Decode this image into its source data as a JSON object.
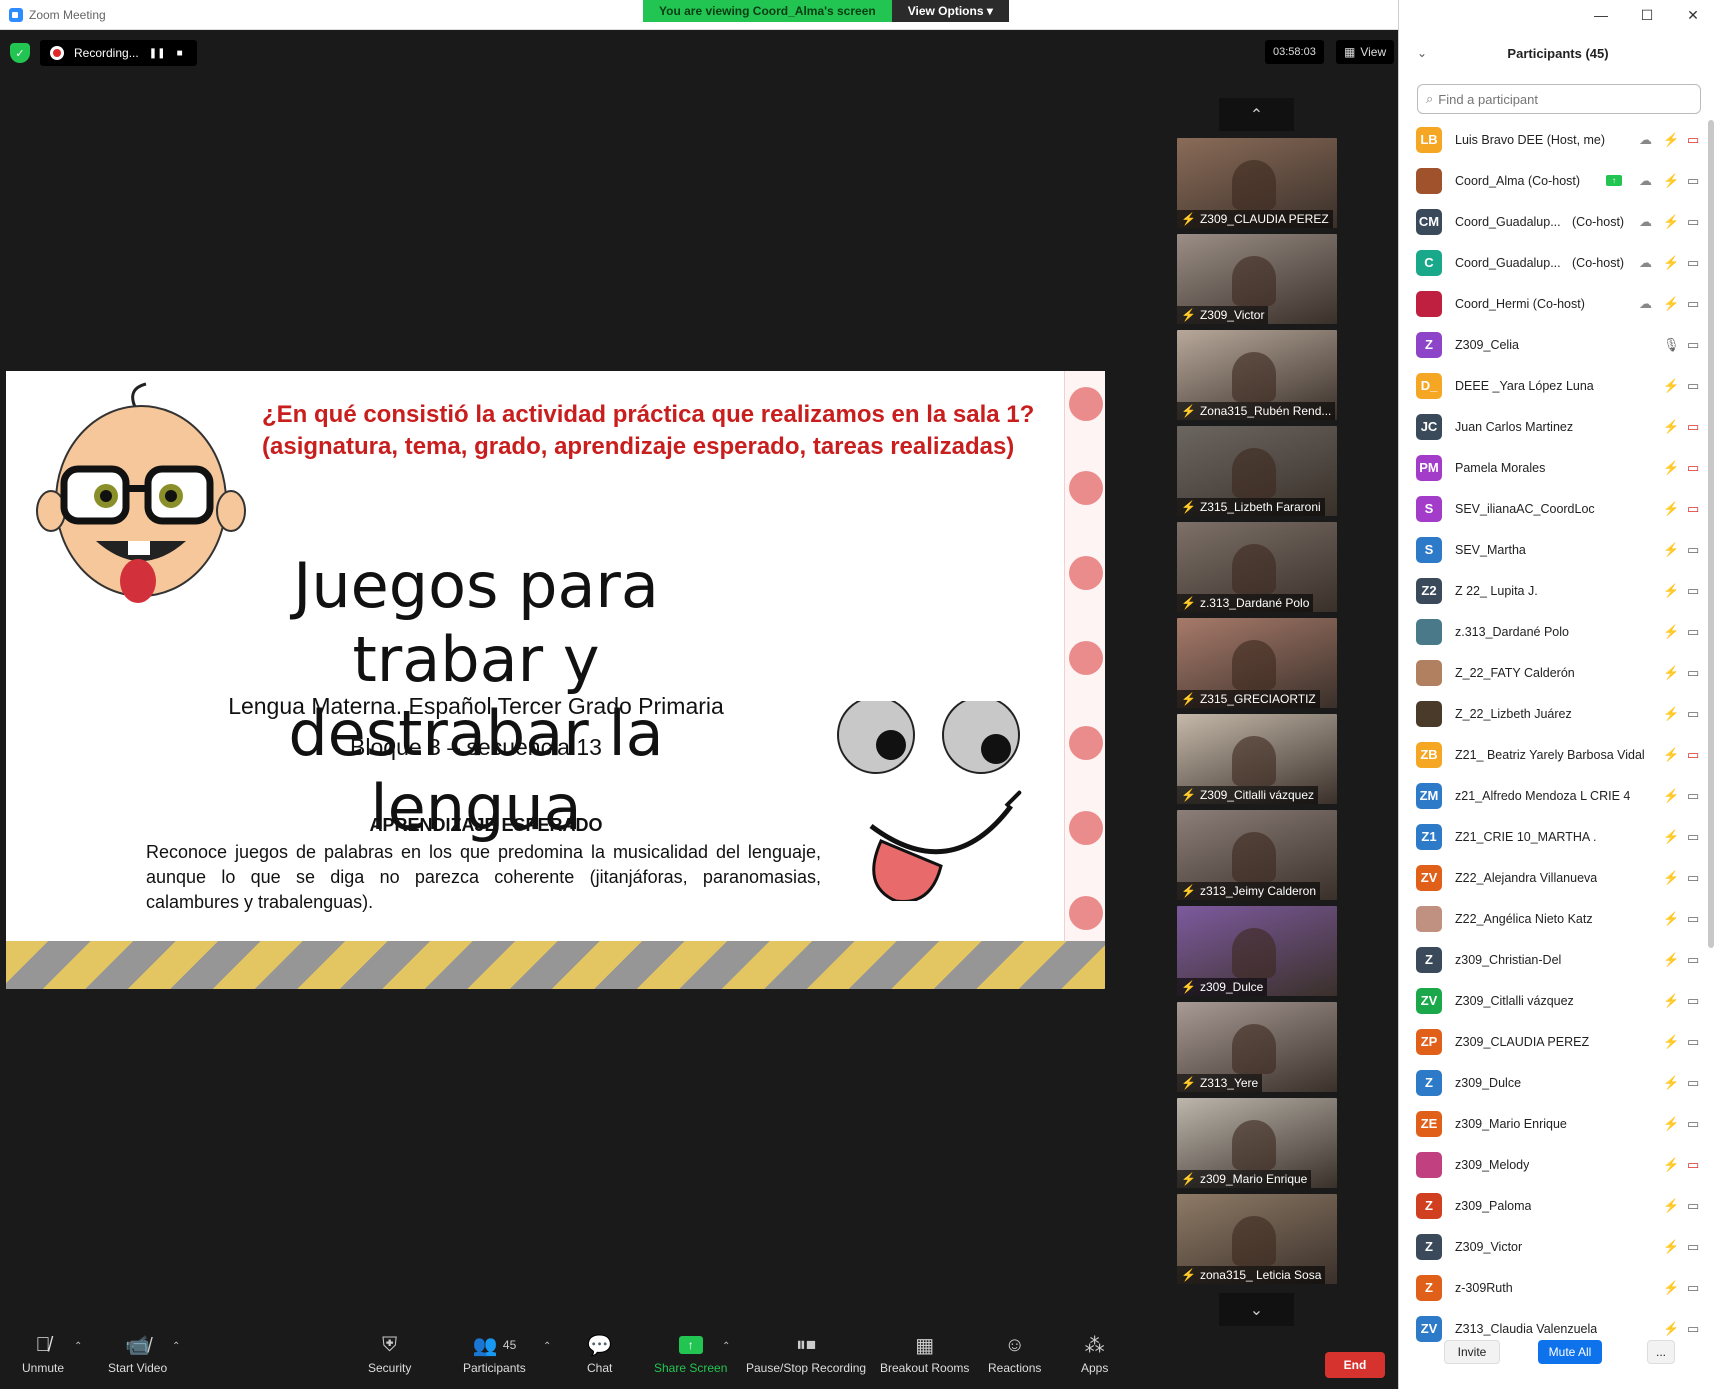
{
  "window": {
    "title": "Zoom Meeting",
    "controls": [
      "—",
      "☐",
      "✕"
    ]
  },
  "banner": {
    "viewing": "You are viewing Coord_Alma's screen",
    "view_options": "View Options ▾"
  },
  "recording": {
    "label": "Recording...",
    "pause": "❚❚",
    "stop": "■"
  },
  "timer": "03:58:03",
  "view_button": "View",
  "slide": {
    "question_line1": "¿En qué consistió la actividad práctica que realizamos en la sala 1?",
    "question_line2": "(asignatura, tema, grado, aprendizaje esperado, tareas realizadas)",
    "title_line1": "Juegos para trabar y",
    "title_line2": "destrabar la lengua",
    "subtitle": "Lengua Materna. Español Tercer Grado Primaria",
    "block": "Bloque 3 – secuencia 13",
    "expected_heading": "APRENDIZAJE ESPERADO",
    "expected_text": "Reconoce juegos de palabras en los que predomina la musicalidad del lenguaje, aunque lo que se diga no parezca coherente (jitanjáforas, paranomasias, calambures y trabalenguas)."
  },
  "gallery": {
    "up_arrow": "⌃",
    "down_arrow": "⌄",
    "tiles": [
      {
        "name": "Z309_CLAUDIA PEREZ",
        "bg": "#8a6b58"
      },
      {
        "name": "Z309_Victor",
        "bg": "#9a8e86"
      },
      {
        "name": "Zona315_Rubén Rend...",
        "bg": "#b7a89a"
      },
      {
        "name": "Z315_Lizbeth Fararoni",
        "bg": "#6c6660"
      },
      {
        "name": "z.313_Dardané Polo",
        "bg": "#7c7068"
      },
      {
        "name": "Z315_GRECIAORTIZ",
        "bg": "#a77a6a"
      },
      {
        "name": "Z309_Citlalli vázquez",
        "bg": "#c5b9aa"
      },
      {
        "name": "z313_Jeimy Calderon",
        "bg": "#8c7e78"
      },
      {
        "name": "z309_Dulce",
        "bg": "#7d5a9e"
      },
      {
        "name": "Z313_Yere",
        "bg": "#a89a94"
      },
      {
        "name": "z309_Mario Enrique",
        "bg": "#bcb6ac"
      },
      {
        "name": "zona315_ Leticia Sosa",
        "bg": "#8e7a66"
      }
    ]
  },
  "toolbar": {
    "unmute": "Unmute",
    "start_video": "Start Video",
    "security": "Security",
    "participants": "Participants",
    "participants_count": "45",
    "chat": "Chat",
    "share_screen": "Share Screen",
    "pause_stop": "Pause/Stop Recording",
    "breakout": "Breakout Rooms",
    "reactions": "Reactions",
    "apps": "Apps",
    "end": "End"
  },
  "panel": {
    "title": "Participants (45)",
    "search_placeholder": "Find a participant",
    "invite": "Invite",
    "mute_all": "Mute All",
    "more": "...",
    "participants": [
      {
        "initials": "LB",
        "color": "#f5a623",
        "name": "Luis Bravo DEE (Host, me)",
        "role": "",
        "cloud": true,
        "share": false,
        "mic_on": false,
        "cam_off": true
      },
      {
        "initials": "",
        "color": "#a0522d",
        "name": "Coord_Alma (Co-host)",
        "role": "",
        "cloud": true,
        "share": true,
        "mic_on": false,
        "cam_off": false
      },
      {
        "initials": "CM",
        "color": "#3a4a5a",
        "name": "Coord_Guadalup...",
        "role": "(Co-host)",
        "cloud": true,
        "share": false,
        "mic_on": false,
        "cam_off": false
      },
      {
        "initials": "C",
        "color": "#1aa88a",
        "name": "Coord_Guadalup...",
        "role": "(Co-host)",
        "cloud": true,
        "share": false,
        "mic_on": false,
        "cam_off": false
      },
      {
        "initials": "",
        "color": "#c02040",
        "name": "Coord_Hermi (Co-host)",
        "role": "",
        "cloud": true,
        "share": false,
        "mic_on": false,
        "cam_off": false
      },
      {
        "initials": "Z",
        "color": "#8e44c9",
        "name": "Z309_Celia",
        "role": "",
        "cloud": false,
        "share": false,
        "mic_on": true,
        "cam_off": false
      },
      {
        "initials": "D_",
        "color": "#f5a623",
        "name": "DEEE _Yara López Luna",
        "role": "",
        "cloud": false,
        "share": false,
        "mic_on": false,
        "cam_off": false
      },
      {
        "initials": "JC",
        "color": "#3a4a5a",
        "name": "Juan Carlos Martinez",
        "role": "",
        "cloud": false,
        "share": false,
        "mic_on": false,
        "cam_off": true
      },
      {
        "initials": "PM",
        "color": "#a23cc9",
        "name": "Pamela Morales",
        "role": "",
        "cloud": false,
        "share": false,
        "mic_on": false,
        "cam_off": true
      },
      {
        "initials": "S",
        "color": "#a23cc9",
        "name": "SEV_ilianaAC_CoordLoc",
        "role": "",
        "cloud": false,
        "share": false,
        "mic_on": false,
        "cam_off": true
      },
      {
        "initials": "S",
        "color": "#2d7ac9",
        "name": "SEV_Martha",
        "role": "",
        "cloud": false,
        "share": false,
        "mic_on": false,
        "cam_off": false
      },
      {
        "initials": "Z2",
        "color": "#3a4a5a",
        "name": "Z 22_ Lupita J.",
        "role": "",
        "cloud": false,
        "share": false,
        "mic_on": false,
        "cam_off": false
      },
      {
        "initials": "",
        "color": "#4a7a8a",
        "name": "z.313_Dardané Polo",
        "role": "",
        "cloud": false,
        "share": false,
        "mic_on": false,
        "cam_off": false
      },
      {
        "initials": "",
        "color": "#b08060",
        "name": "Z_22_FATY Calderón",
        "role": "",
        "cloud": false,
        "share": false,
        "mic_on": false,
        "cam_off": false
      },
      {
        "initials": "",
        "color": "#4a3a2a",
        "name": "Z_22_Lizbeth Juárez",
        "role": "",
        "cloud": false,
        "share": false,
        "mic_on": false,
        "cam_off": false
      },
      {
        "initials": "ZB",
        "color": "#f5a623",
        "name": "Z21_ Beatriz Yarely Barbosa Vidal",
        "role": "",
        "cloud": false,
        "share": false,
        "mic_on": false,
        "cam_off": true
      },
      {
        "initials": "ZM",
        "color": "#2d7ac9",
        "name": "z21_Alfredo Mendoza L CRIE 4",
        "role": "",
        "cloud": false,
        "share": false,
        "mic_on": false,
        "cam_off": false
      },
      {
        "initials": "Z1",
        "color": "#2d7ac9",
        "name": "Z21_CRIE 10_MARTHA .",
        "role": "",
        "cloud": false,
        "share": false,
        "mic_on": false,
        "cam_off": false
      },
      {
        "initials": "ZV",
        "color": "#e0601a",
        "name": "Z22_Alejandra Villanueva",
        "role": "",
        "cloud": false,
        "share": false,
        "mic_on": false,
        "cam_off": false
      },
      {
        "initials": "",
        "color": "#c09080",
        "name": "Z22_Angélica Nieto Katz",
        "role": "",
        "cloud": false,
        "share": false,
        "mic_on": false,
        "cam_off": false
      },
      {
        "initials": "Z",
        "color": "#3a4a5a",
        "name": "z309_Christian-Del",
        "role": "",
        "cloud": false,
        "share": false,
        "mic_on": false,
        "cam_off": false
      },
      {
        "initials": "ZV",
        "color": "#1aa84a",
        "name": "Z309_Citlalli vázquez",
        "role": "",
        "cloud": false,
        "share": false,
        "mic_on": false,
        "cam_off": false
      },
      {
        "initials": "ZP",
        "color": "#e0601a",
        "name": "Z309_CLAUDIA PEREZ",
        "role": "",
        "cloud": false,
        "share": false,
        "mic_on": false,
        "cam_off": false
      },
      {
        "initials": "Z",
        "color": "#2d7ac9",
        "name": "z309_Dulce",
        "role": "",
        "cloud": false,
        "share": false,
        "mic_on": false,
        "cam_off": false
      },
      {
        "initials": "ZE",
        "color": "#e0601a",
        "name": "z309_Mario Enrique",
        "role": "",
        "cloud": false,
        "share": false,
        "mic_on": false,
        "cam_off": false
      },
      {
        "initials": "",
        "color": "#c04080",
        "name": "z309_Melody",
        "role": "",
        "cloud": false,
        "share": false,
        "mic_on": false,
        "cam_off": true
      },
      {
        "initials": "Z",
        "color": "#d04020",
        "name": "z309_Paloma",
        "role": "",
        "cloud": false,
        "share": false,
        "mic_on": false,
        "cam_off": false
      },
      {
        "initials": "Z",
        "color": "#3a4a5a",
        "name": "Z309_Victor",
        "role": "",
        "cloud": false,
        "share": false,
        "mic_on": false,
        "cam_off": false
      },
      {
        "initials": "Z",
        "color": "#e0601a",
        "name": "z-309Ruth",
        "role": "",
        "cloud": false,
        "share": false,
        "mic_on": false,
        "cam_off": false
      },
      {
        "initials": "ZV",
        "color": "#2d7ac9",
        "name": "Z313_Claudia Valenzuela",
        "role": "",
        "cloud": false,
        "share": false,
        "mic_on": false,
        "cam_off": false
      }
    ]
  }
}
